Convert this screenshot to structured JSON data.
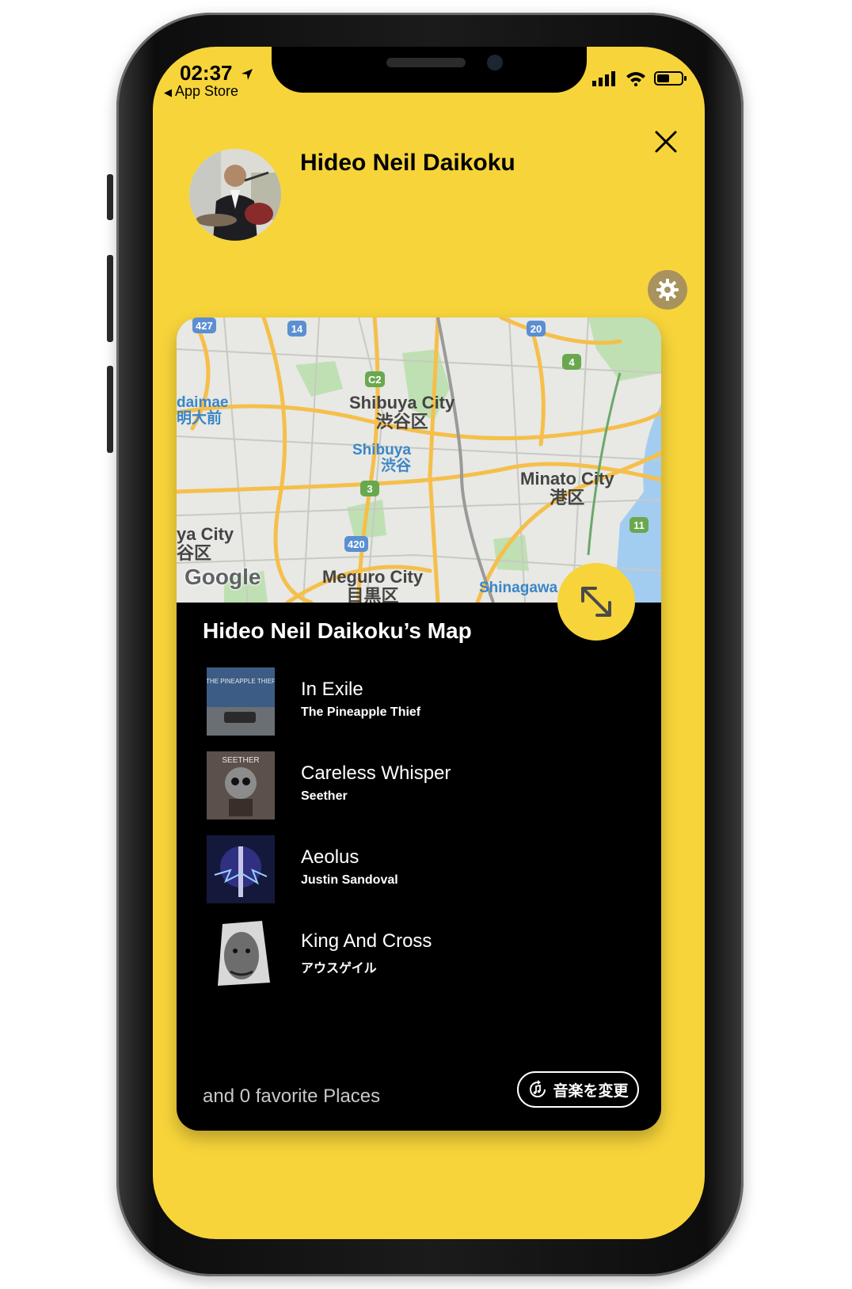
{
  "status_bar": {
    "time": "02:37",
    "back_label": "App Store"
  },
  "profile": {
    "name": "Hideo Neil Daikoku"
  },
  "map": {
    "labels": {
      "shibuya_city_en": "Shibuya City",
      "shibuya_city_jp": "渋谷区",
      "shibuya_en": "Shibuya",
      "shibuya_jp": "渋谷",
      "minato_en": "Minato City",
      "minato_jp": "港区",
      "meguro_en": "Meguro City",
      "meguro_jp": "目黒区",
      "setagaya_en": "ya City",
      "setagaya_jp": "谷区",
      "meidaimae_en": "daimae",
      "meidaimae_jp": "明大前",
      "shinagawa_en": "Shinagawa"
    },
    "roads": [
      "427",
      "14",
      "20",
      "4",
      "C2",
      "3",
      "420",
      "11"
    ],
    "attribution": "Google"
  },
  "card": {
    "title": "Hideo Neil Daikoku’s Map",
    "tracks": [
      {
        "title": "In Exile",
        "artist": "The Pineapple Thief",
        "cover_text": "THE PINEAPPLE THIEF"
      },
      {
        "title": "Careless Whisper",
        "artist": "Seether",
        "cover_text": "SEETHER"
      },
      {
        "title": "Aeolus",
        "artist": "Justin Sandoval"
      },
      {
        "title": "King And Cross",
        "artist": "アウスゲイル"
      }
    ],
    "footer_text": "and 0 favorite Places",
    "change_music_label": "音楽を変更"
  },
  "colors": {
    "accent_yellow": "#f7d43a",
    "card_black": "#000000",
    "settings_gold": "#a8925e"
  }
}
